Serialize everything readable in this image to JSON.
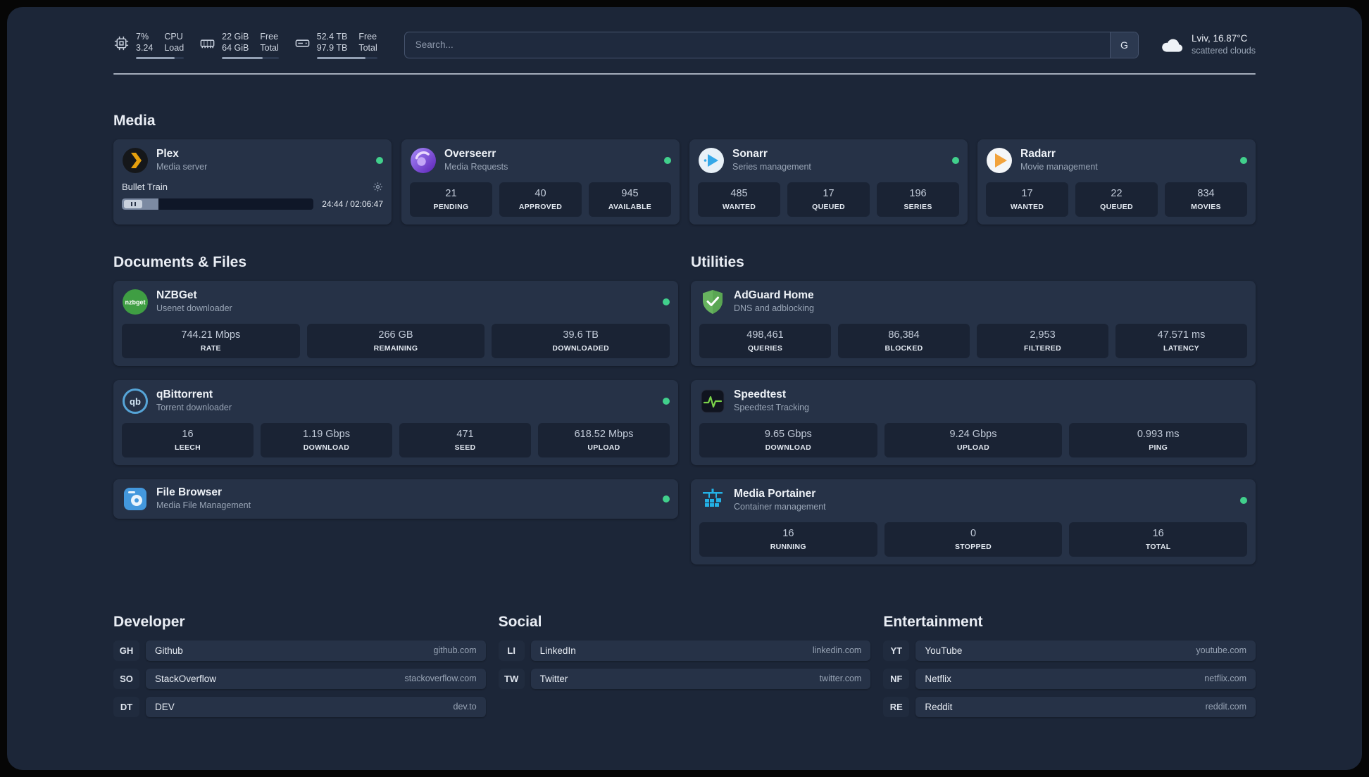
{
  "colors": {
    "background": "#1c2638",
    "card": "#263247",
    "stat_block": "#1a2334",
    "status_online": "#41d08c",
    "text_primary": "#e7ecf3",
    "text_secondary": "#98a4b5"
  },
  "topbar": {
    "cpu": {
      "value_top": "7%",
      "value_bottom": "3.24",
      "label_top": "CPU",
      "label_bottom": "Load"
    },
    "memory": {
      "value_top": "22 GiB",
      "value_bottom": "64 GiB",
      "label_top": "Free",
      "label_bottom": "Total"
    },
    "disk": {
      "value_top": "52.4 TB",
      "value_bottom": "97.9 TB",
      "label_top": "Free",
      "label_bottom": "Total"
    },
    "search": {
      "placeholder": "Search...",
      "button": "G"
    },
    "weather": {
      "location": "Lviv, 16.87°C",
      "condition": "scattered clouds"
    }
  },
  "sections": {
    "media": {
      "title": "Media",
      "plex": {
        "name": "Plex",
        "desc": "Media server",
        "now_playing": "Bullet Train",
        "time": "24:44 / 02:06:47"
      },
      "overseerr": {
        "name": "Overseerr",
        "desc": "Media Requests",
        "stats": [
          {
            "value": "21",
            "label": "PENDING"
          },
          {
            "value": "40",
            "label": "APPROVED"
          },
          {
            "value": "945",
            "label": "AVAILABLE"
          }
        ]
      },
      "sonarr": {
        "name": "Sonarr",
        "desc": "Series management",
        "stats": [
          {
            "value": "485",
            "label": "WANTED"
          },
          {
            "value": "17",
            "label": "QUEUED"
          },
          {
            "value": "196",
            "label": "SERIES"
          }
        ]
      },
      "radarr": {
        "name": "Radarr",
        "desc": "Movie management",
        "stats": [
          {
            "value": "17",
            "label": "WANTED"
          },
          {
            "value": "22",
            "label": "QUEUED"
          },
          {
            "value": "834",
            "label": "MOVIES"
          }
        ]
      }
    },
    "documents": {
      "title": "Documents & Files",
      "nzbget": {
        "name": "NZBGet",
        "desc": "Usenet downloader",
        "stats": [
          {
            "value": "744.21 Mbps",
            "label": "RATE"
          },
          {
            "value": "266 GB",
            "label": "REMAINING"
          },
          {
            "value": "39.6 TB",
            "label": "DOWNLOADED"
          }
        ]
      },
      "qbittorrent": {
        "name": "qBittorrent",
        "desc": "Torrent downloader",
        "stats": [
          {
            "value": "16",
            "label": "LEECH"
          },
          {
            "value": "1.19 Gbps",
            "label": "DOWNLOAD"
          },
          {
            "value": "471",
            "label": "SEED"
          },
          {
            "value": "618.52 Mbps",
            "label": "UPLOAD"
          }
        ]
      },
      "filebrowser": {
        "name": "File Browser",
        "desc": "Media File Management"
      }
    },
    "utilities": {
      "title": "Utilities",
      "adguard": {
        "name": "AdGuard Home",
        "desc": "DNS and adblocking",
        "stats": [
          {
            "value": "498,461",
            "label": "QUERIES"
          },
          {
            "value": "86,384",
            "label": "BLOCKED"
          },
          {
            "value": "2,953",
            "label": "FILTERED"
          },
          {
            "value": "47.571 ms",
            "label": "LATENCY"
          }
        ]
      },
      "speedtest": {
        "name": "Speedtest",
        "desc": "Speedtest Tracking",
        "stats": [
          {
            "value": "9.65 Gbps",
            "label": "DOWNLOAD"
          },
          {
            "value": "9.24 Gbps",
            "label": "UPLOAD"
          },
          {
            "value": "0.993 ms",
            "label": "PING"
          }
        ]
      },
      "portainer": {
        "name": "Media Portainer",
        "desc": "Container management",
        "stats": [
          {
            "value": "16",
            "label": "RUNNING"
          },
          {
            "value": "0",
            "label": "STOPPED"
          },
          {
            "value": "16",
            "label": "TOTAL"
          }
        ]
      }
    },
    "bookmarks": {
      "developer": {
        "title": "Developer",
        "items": [
          {
            "abbr": "GH",
            "name": "Github",
            "domain": "github.com"
          },
          {
            "abbr": "SO",
            "name": "StackOverflow",
            "domain": "stackoverflow.com"
          },
          {
            "abbr": "DT",
            "name": "DEV",
            "domain": "dev.to"
          }
        ]
      },
      "social": {
        "title": "Social",
        "items": [
          {
            "abbr": "LI",
            "name": "LinkedIn",
            "domain": "linkedin.com"
          },
          {
            "abbr": "TW",
            "name": "Twitter",
            "domain": "twitter.com"
          }
        ]
      },
      "entertainment": {
        "title": "Entertainment",
        "items": [
          {
            "abbr": "YT",
            "name": "YouTube",
            "domain": "youtube.com"
          },
          {
            "abbr": "NF",
            "name": "Netflix",
            "domain": "netflix.com"
          },
          {
            "abbr": "RE",
            "name": "Reddit",
            "domain": "reddit.com"
          }
        ]
      }
    }
  }
}
